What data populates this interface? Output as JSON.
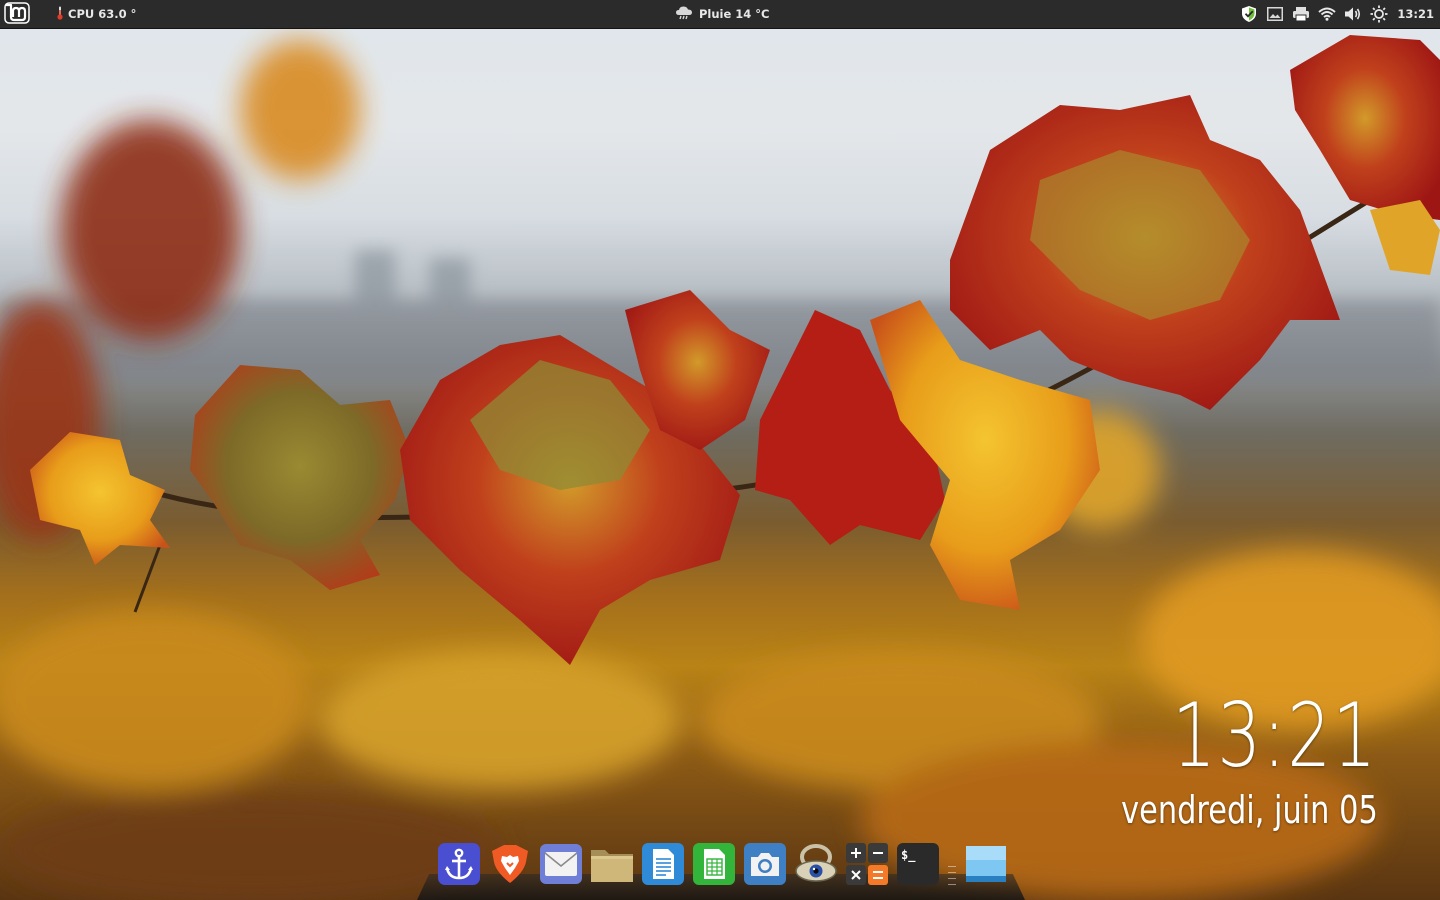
{
  "panel": {
    "cpu_label": "CPU",
    "cpu_value": "63.0 °",
    "weather_label": "Pluie 14 °C",
    "clock": "13:21"
  },
  "desklet": {
    "time": "13:21",
    "date": "vendredi, juin 05"
  },
  "icons": {
    "menu": "linux-mint-menu-icon",
    "cpu": "thermometer-icon",
    "weather": "rain-cloud-icon",
    "tray": [
      "shield-check-icon",
      "image-viewer-icon",
      "printer-icon",
      "wifi-icon",
      "volume-icon",
      "brightness-icon"
    ],
    "dock": [
      "anchor-icon",
      "brave-browser-icon",
      "mail-icon",
      "file-manager-icon",
      "text-document-icon",
      "spreadsheet-icon",
      "screenshot-camera-icon",
      "eye-viewer-icon",
      "calculator-icon",
      "terminal-icon",
      "desktop-window-icon"
    ]
  },
  "terminal_prompt": "$_",
  "colors": {
    "panel_bg": "#2b2b2b",
    "mint_green": "#7dbf44",
    "brave_orange": "#f05a24",
    "anchor_blue": "#4a4ed0",
    "spreadsheet_green": "#33b43a",
    "doc_blue": "#2f8ad8",
    "calc_orange": "#f47a2a"
  }
}
